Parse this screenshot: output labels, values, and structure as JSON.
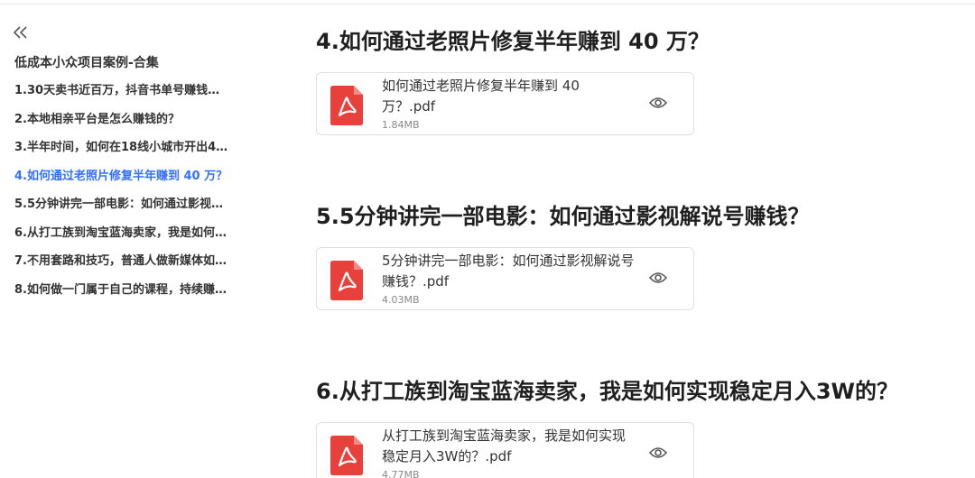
{
  "sidebar": {
    "collapse_glyph": "«",
    "title": "低成本小众项目案例-合集",
    "items": [
      {
        "label": "1.30天卖书近百万，抖音书单号赚钱…",
        "active": false
      },
      {
        "label": "2.本地相亲平台是怎么赚钱的？",
        "active": false
      },
      {
        "label": "3.半年时间，如何在18线小城市开出4…",
        "active": false
      },
      {
        "label": "4.如何通过老照片修复半年赚到 40 万？",
        "active": true
      },
      {
        "label": "5.5分钟讲完一部电影：如何通过影视…",
        "active": false
      },
      {
        "label": "6.从打工族到淘宝蓝海卖家，我是如何…",
        "active": false
      },
      {
        "label": "7.不用套路和技巧，普通人做新媒体如…",
        "active": false
      },
      {
        "label": "8.如何做一门属于自己的课程，持续赚…",
        "active": false
      }
    ]
  },
  "sections": [
    {
      "heading": "4.如何通过老照片修复半年赚到 40 万？",
      "file_name": "如何通过老照片修复半年赚到 40 万？.pdf",
      "file_size": "1.84MB"
    },
    {
      "heading": "5.5分钟讲完一部电影：如何通过影视解说号赚钱？",
      "file_name": "5分钟讲完一部电影：如何通过影视解说号赚钱？.pdf",
      "file_size": "4.03MB"
    },
    {
      "heading": "6.从打工族到淘宝蓝海卖家，我是如何实现稳定月入3W的？",
      "file_name": "从打工族到淘宝蓝海卖家，我是如何实现稳定月入3W的？.pdf",
      "file_size": "4.77MB"
    }
  ],
  "icons": {
    "collapse": "double-chevron-left-icon",
    "file": "pdf-file-icon",
    "preview": "eye-icon"
  },
  "colors": {
    "accent": "#3370ff",
    "pdf_red": "#e8413c",
    "text": "#1f1f1f"
  }
}
